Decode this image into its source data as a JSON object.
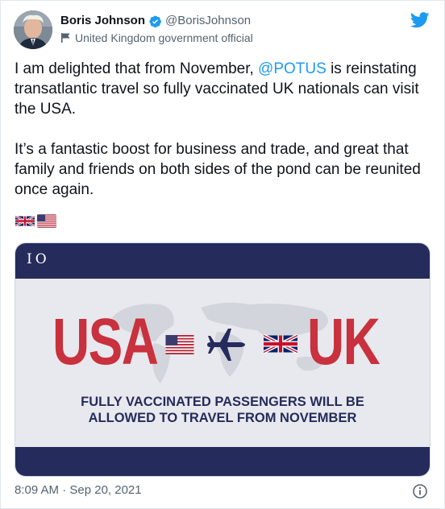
{
  "author": {
    "display_name": "Boris Johnson",
    "handle": "@BorisJohnson",
    "label": "United Kingdom government official"
  },
  "tweet": {
    "line1_before": "I am delighted that from November, ",
    "mention": "@POTUS",
    "line1_after": " is reinstating transatlantic travel so fully vaccinated UK nationals can visit the USA.",
    "paragraph2": "It’s a fantastic boost for business and trade, and great that family and friends on both sides of the pond can be reunited once again.",
    "emojis": [
      "uk-flag",
      "us-flag"
    ]
  },
  "media": {
    "brand": "IO",
    "left_word": "USA",
    "right_word": "UK",
    "caption_line1": "FULLY VACCINATED PASSENGERS WILL BE",
    "caption_line2": "ALLOWED TO TRAVEL FROM NOVEMBER",
    "colors": {
      "navy": "#252c5c",
      "red": "#c8313d"
    }
  },
  "footer": {
    "timestamp": "8:09 AM · Sep 20, 2021"
  },
  "icons": [
    "verified-badge-icon",
    "flag-icon",
    "twitter-bird-icon",
    "info-icon"
  ],
  "colors": {
    "twitter_blue": "#1d9bf0",
    "secondary_text": "#536471"
  }
}
